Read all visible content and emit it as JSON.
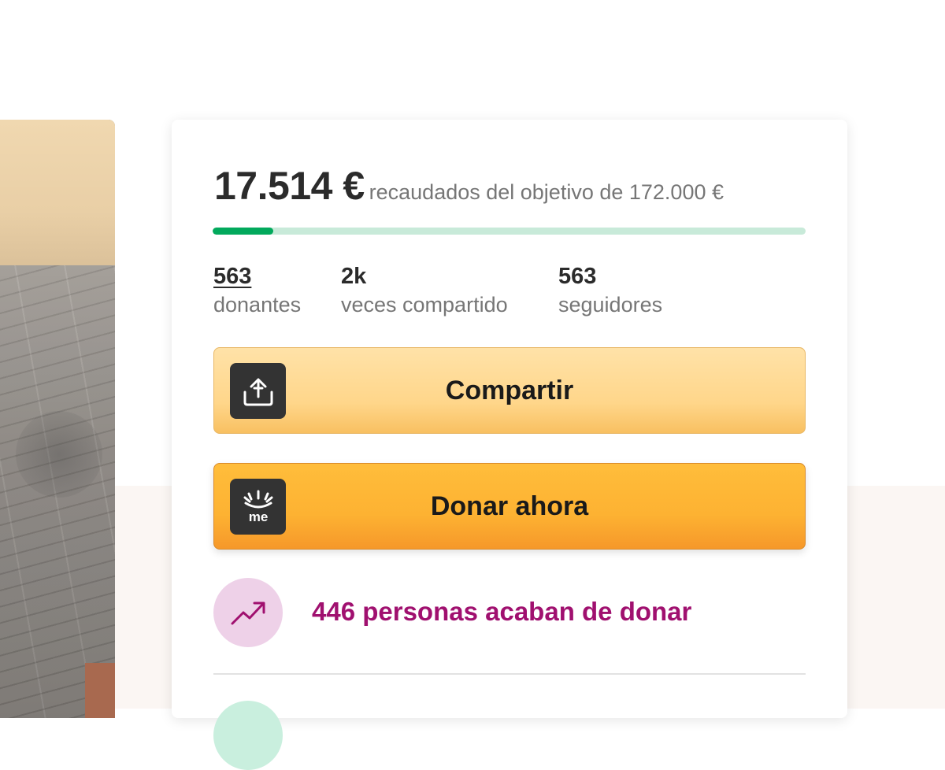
{
  "campaign": {
    "raised_amount": "17.514 €",
    "goal_text": "recaudados del objetivo de 172.000 €",
    "progress_fraction": 0.102
  },
  "stats": [
    {
      "value": "563",
      "label": "donantes"
    },
    {
      "value": "2k",
      "label": "veces compartido"
    },
    {
      "value": "563",
      "label": "seguidores"
    }
  ],
  "buttons": {
    "share_label": "Compartir",
    "donate_label": "Donar ahora"
  },
  "icons": {
    "share": "share-upload-icon",
    "donate": "gofundme-logo-icon",
    "activity": "trending-up-icon"
  },
  "activity": {
    "text": "446 personas acaban de donar"
  },
  "colors": {
    "progress": "#02a95c",
    "progress_track": "#c8ead9",
    "share_button": "#ffd68a",
    "donate_button": "#fdb232",
    "activity_text": "#a0106f",
    "activity_icon_bg": "#eed1e8"
  }
}
